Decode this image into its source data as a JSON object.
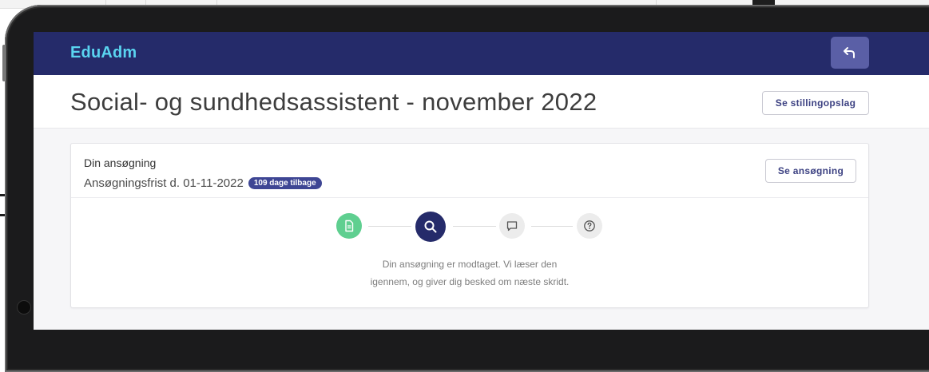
{
  "app": {
    "logo": "EduAdm"
  },
  "colors": {
    "topbar": "#252b6a",
    "accent": "#3e4694",
    "done_step": "#5fcf90",
    "active_step": "#252b6a"
  },
  "header": {
    "back_icon": "undo-arrow-icon"
  },
  "page": {
    "title": "Social- og sundhedsassistent - november 2022",
    "view_posting_label": "Se stillingopslag"
  },
  "application": {
    "title": "Din ansøgning",
    "deadline": "Ansøgningsfrist d. 01-11-2022",
    "days_badge": "109 dage tilbage",
    "view_label": "Se ansøgning",
    "steps": [
      {
        "icon": "document-icon",
        "state": "done"
      },
      {
        "icon": "search-icon",
        "state": "active"
      },
      {
        "icon": "chat-icon",
        "state": "pending"
      },
      {
        "icon": "question-icon",
        "state": "pending"
      }
    ],
    "status_line1": "Din ansøgning er modtaget. Vi læser den",
    "status_line2": "igennem, og giver dig besked om næste skridt."
  }
}
